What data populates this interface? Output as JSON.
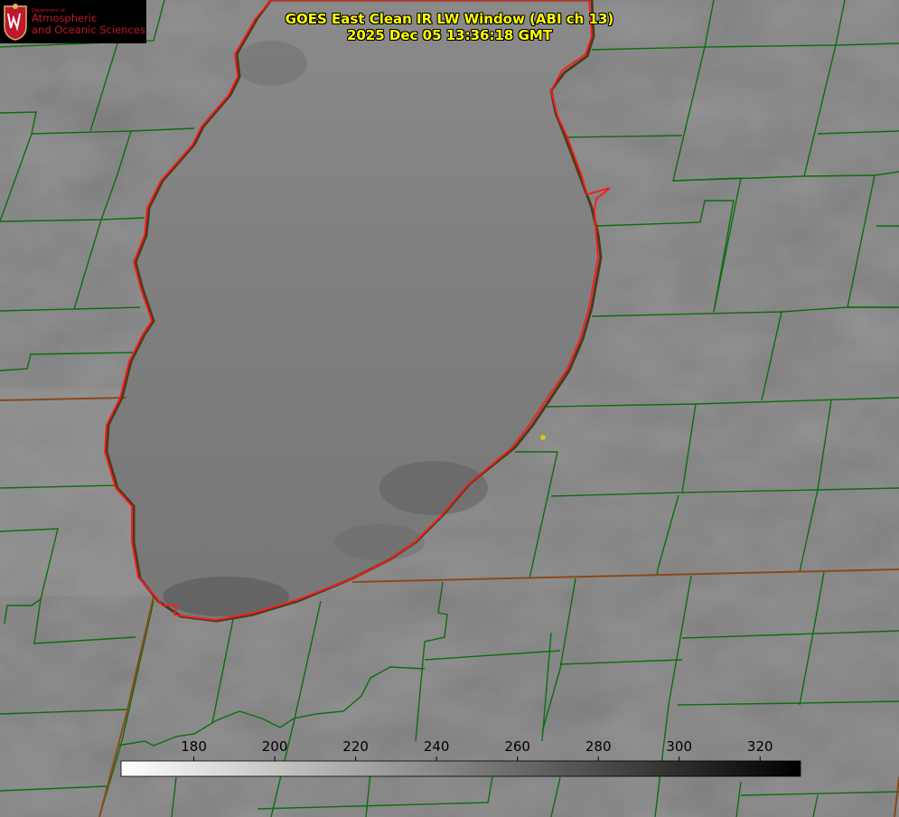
{
  "title": {
    "line1": "GOES East Clean IR LW Window (ABI ch 13)",
    "line2": "2025 Dec 05 13:36:18 GMT"
  },
  "logo": {
    "dept_small": "Department of",
    "line1": "Atmospheric",
    "line2": "and Oceanic Sciences",
    "brand_color": "#c0172c"
  },
  "colorbar": {
    "ticks": [
      "180",
      "200",
      "220",
      "240",
      "260",
      "280",
      "300",
      "320"
    ],
    "range": [
      162,
      330
    ],
    "scale": "white-to-black"
  },
  "colors": {
    "county_lines": "#0c6e0c",
    "shoreline": "#ff1a1a",
    "state_lines": "#8a4a1a",
    "marker": "#d4c21a"
  }
}
